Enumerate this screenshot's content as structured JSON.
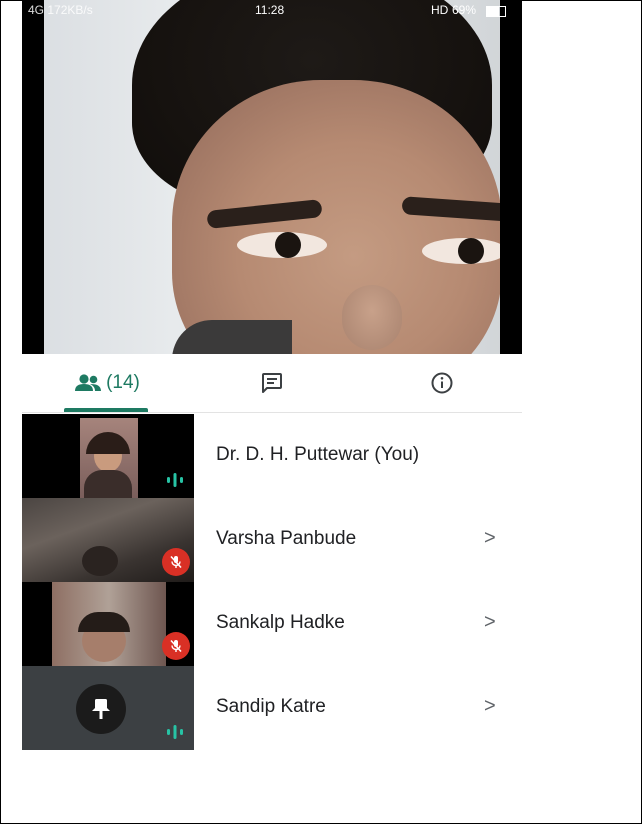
{
  "status_bar": {
    "left_info": "4G 172KB/s",
    "time": "11:28",
    "network_badge": "HD",
    "battery": "69%",
    "battery_level": 0.69
  },
  "tabs": {
    "people_icon": "people-icon",
    "people_count": "(14)",
    "chat_icon": "chat-icon",
    "info_icon": "info-icon",
    "active_color": "#1e7a62"
  },
  "participants": [
    {
      "name": "Dr. D. H. Puttewar (You)",
      "state": "speaking",
      "has_chevron": false
    },
    {
      "name": "Varsha Panbude",
      "state": "muted",
      "has_chevron": true,
      "chevron": ">"
    },
    {
      "name": "Sankalp Hadke",
      "state": "muted",
      "has_chevron": true,
      "chevron": ">"
    },
    {
      "name": "Sandip Katre",
      "state": "speaking",
      "has_chevron": true,
      "chevron": ">"
    }
  ],
  "colors": {
    "mic_off": "#d93025",
    "speaking": "#27c3a5"
  }
}
